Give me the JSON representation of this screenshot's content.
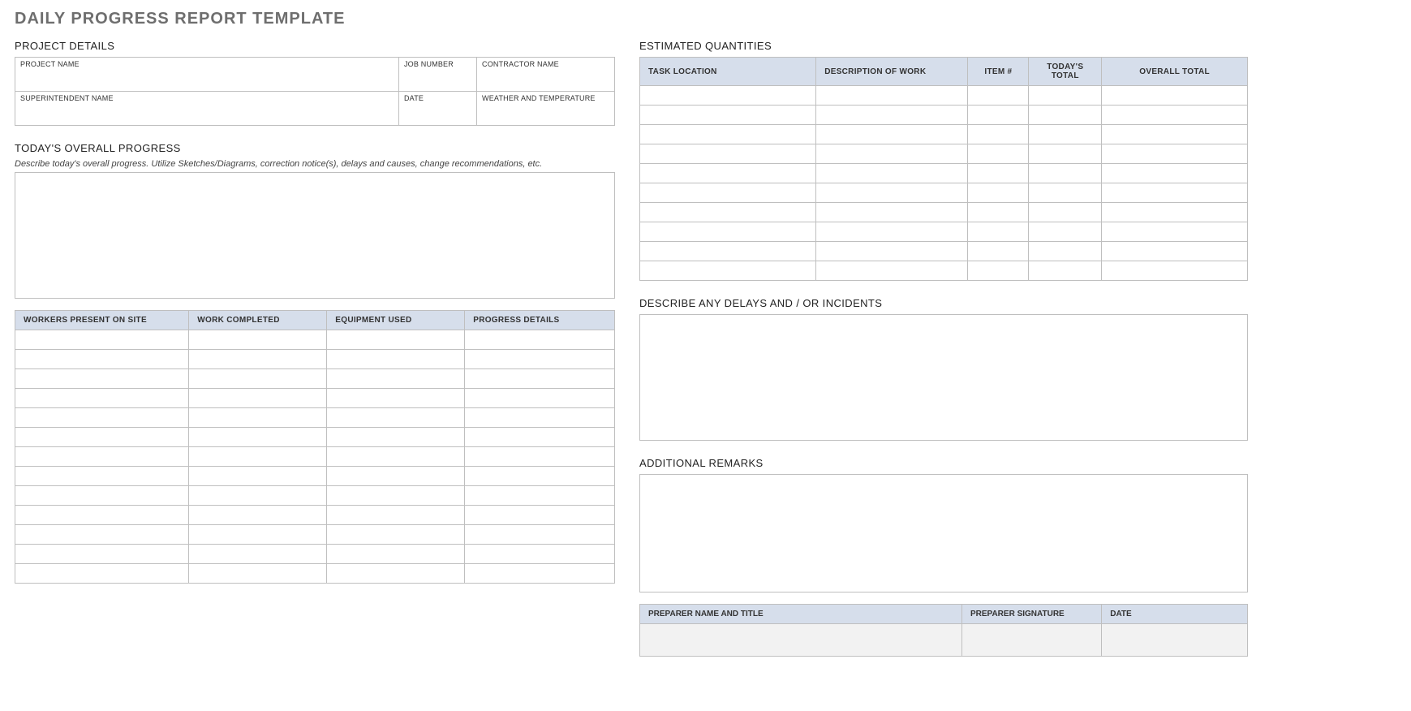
{
  "title": "DAILY PROGRESS REPORT TEMPLATE",
  "sections": {
    "project_details": "PROJECT DETAILS",
    "overall_progress": "TODAY'S OVERALL PROGRESS",
    "estimated_quantities": "ESTIMATED QUANTITIES",
    "delays": "DESCRIBE ANY DELAYS AND / OR INCIDENTS",
    "remarks": "ADDITIONAL REMARKS"
  },
  "progress_hint": "Describe today's overall progress.  Utilize Sketches/Diagrams, correction notice(s), delays and causes, change recommendations, etc.",
  "details_fields": {
    "project_name": "PROJECT NAME",
    "job_number": "JOB NUMBER",
    "contractor_name": "CONTRACTOR NAME",
    "superintendent_name": "SUPERINTENDENT NAME",
    "date": "DATE",
    "weather": "WEATHER AND TEMPERATURE"
  },
  "progress_table": {
    "headers": [
      "WORKERS PRESENT ON SITE",
      "WORK COMPLETED",
      "EQUIPMENT USED",
      "PROGRESS DETAILS"
    ],
    "rows": [
      [
        "",
        "",
        "",
        ""
      ],
      [
        "",
        "",
        "",
        ""
      ],
      [
        "",
        "",
        "",
        ""
      ],
      [
        "",
        "",
        "",
        ""
      ],
      [
        "",
        "",
        "",
        ""
      ],
      [
        "",
        "",
        "",
        ""
      ],
      [
        "",
        "",
        "",
        ""
      ],
      [
        "",
        "",
        "",
        ""
      ],
      [
        "",
        "",
        "",
        ""
      ],
      [
        "",
        "",
        "",
        ""
      ],
      [
        "",
        "",
        "",
        ""
      ],
      [
        "",
        "",
        "",
        ""
      ],
      [
        "",
        "",
        "",
        ""
      ]
    ]
  },
  "quantities_table": {
    "headers": [
      "TASK LOCATION",
      "DESCRIPTION OF WORK",
      "ITEM #",
      "TODAY'S TOTAL",
      "OVERALL TOTAL"
    ],
    "rows": [
      [
        "",
        "",
        "",
        "",
        ""
      ],
      [
        "",
        "",
        "",
        "",
        ""
      ],
      [
        "",
        "",
        "",
        "",
        ""
      ],
      [
        "",
        "",
        "",
        "",
        ""
      ],
      [
        "",
        "",
        "",
        "",
        ""
      ],
      [
        "",
        "",
        "",
        "",
        ""
      ],
      [
        "",
        "",
        "",
        "",
        ""
      ],
      [
        "",
        "",
        "",
        "",
        ""
      ],
      [
        "",
        "",
        "",
        "",
        ""
      ],
      [
        "",
        "",
        "",
        "",
        ""
      ]
    ]
  },
  "signature": {
    "headers": [
      "PREPARER NAME AND TITLE",
      "PREPARER SIGNATURE",
      "DATE"
    ]
  }
}
